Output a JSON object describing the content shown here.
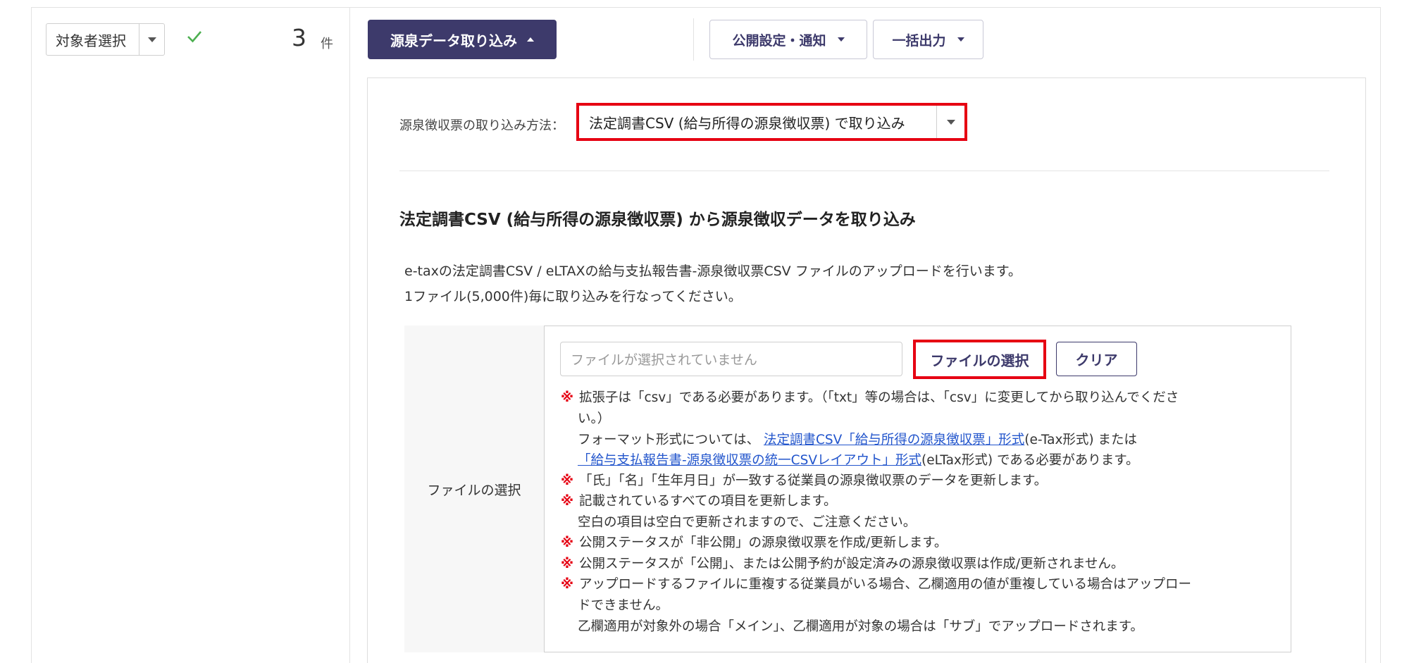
{
  "left": {
    "target_select_label": "対象者選択",
    "count": "3",
    "count_unit": "件"
  },
  "toolbar": {
    "import_label": "源泉データ取り込み",
    "publish_label": "公開設定・通知",
    "export_label": "一括出力"
  },
  "panel": {
    "method_label": "源泉徴収票の取り込み方法：",
    "method_value": "法定調書CSV (給与所得の源泉徴収票) で取り込み",
    "section_title": "法定調書CSV (給与所得の源泉徴収票) から源泉徴収データを取り込み",
    "desc_line1": "e-taxの法定調書CSV / eLTAXの給与支払報告書-源泉徴収票CSV ファイルのアップロードを行います。",
    "desc_line2": "1ファイル(5,000件)毎に取り込みを行なってください。"
  },
  "file_table": {
    "header": "ファイルの選択",
    "input_placeholder": "ファイルが選択されていません",
    "choose_label": "ファイルの選択",
    "clear_label": "クリア"
  },
  "notes": {
    "mark": "※",
    "n1_line1": "拡張子は「csv」である必要があります。（「txt」等の場合は、「csv」に変更してから取り込んでくださ",
    "n1_line2": "い。）",
    "n1_fmt_prefix": "フォーマット形式については、",
    "n1_fmt_link1": "法定調書CSV「給与所得の源泉徴収票」形式",
    "n1_fmt_mid": "(e-Tax形式) または",
    "n1_fmt_link2": "「給与支払報告書-源泉徴収票の統一CSVレイアウト」形式",
    "n1_fmt_suffix": "(eLTax形式) である必要があります。",
    "n2": "「氏」「名」「生年月日」が一致する従業員の源泉徴収票のデータを更新します。",
    "n3_line1": "記載されているすべての項目を更新します。",
    "n3_line2": "空白の項目は空白で更新されますので、ご注意ください。",
    "n4": "公開ステータスが「非公開」の源泉徴収票を作成/更新します。",
    "n5": "公開ステータスが「公開」、または公開予約が設定済みの源泉徴収票は作成/更新されません。",
    "n6_line1": "アップロードするファイルに重複する従業員がいる場合、乙欄適用の値が重複している場合はアップロー",
    "n6_line2": "ドできません。",
    "n6_line3": "乙欄適用が対象外の場合「メイン」、乙欄適用が対象の場合は「サブ」でアップロードされます。"
  },
  "colors": {
    "primary": "#3d3a6b",
    "highlight": "#e60012",
    "check": "#4caf50",
    "link": "#2255cc"
  }
}
